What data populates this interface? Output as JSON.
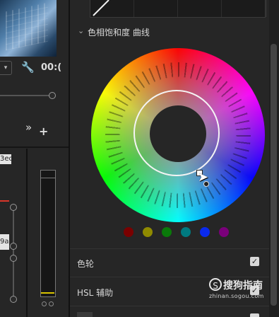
{
  "left": {
    "timecode": "00:(",
    "more_label": "»",
    "add_label": "+",
    "clip_label": "3ed",
    "clip2_label": "9a"
  },
  "color_section": {
    "title": "色相饱和度 曲线",
    "swatches": [
      "#7a0000",
      "#8f8a00",
      "#0a7a0a",
      "#007a80",
      "#0a2aee",
      "#7a007a"
    ]
  },
  "rows": [
    {
      "label": "色轮",
      "checked": true
    },
    {
      "label": "HSL 辅助",
      "checked": true
    }
  ],
  "icons": {
    "wrench": "wrench-icon",
    "chevron": "chevron-down-icon",
    "cursor": "cursor-arrow-icon",
    "check": "✓"
  },
  "watermark": {
    "logo_glyph": "S",
    "text": "搜狗指南",
    "url": "zhinan.sogou.com"
  }
}
